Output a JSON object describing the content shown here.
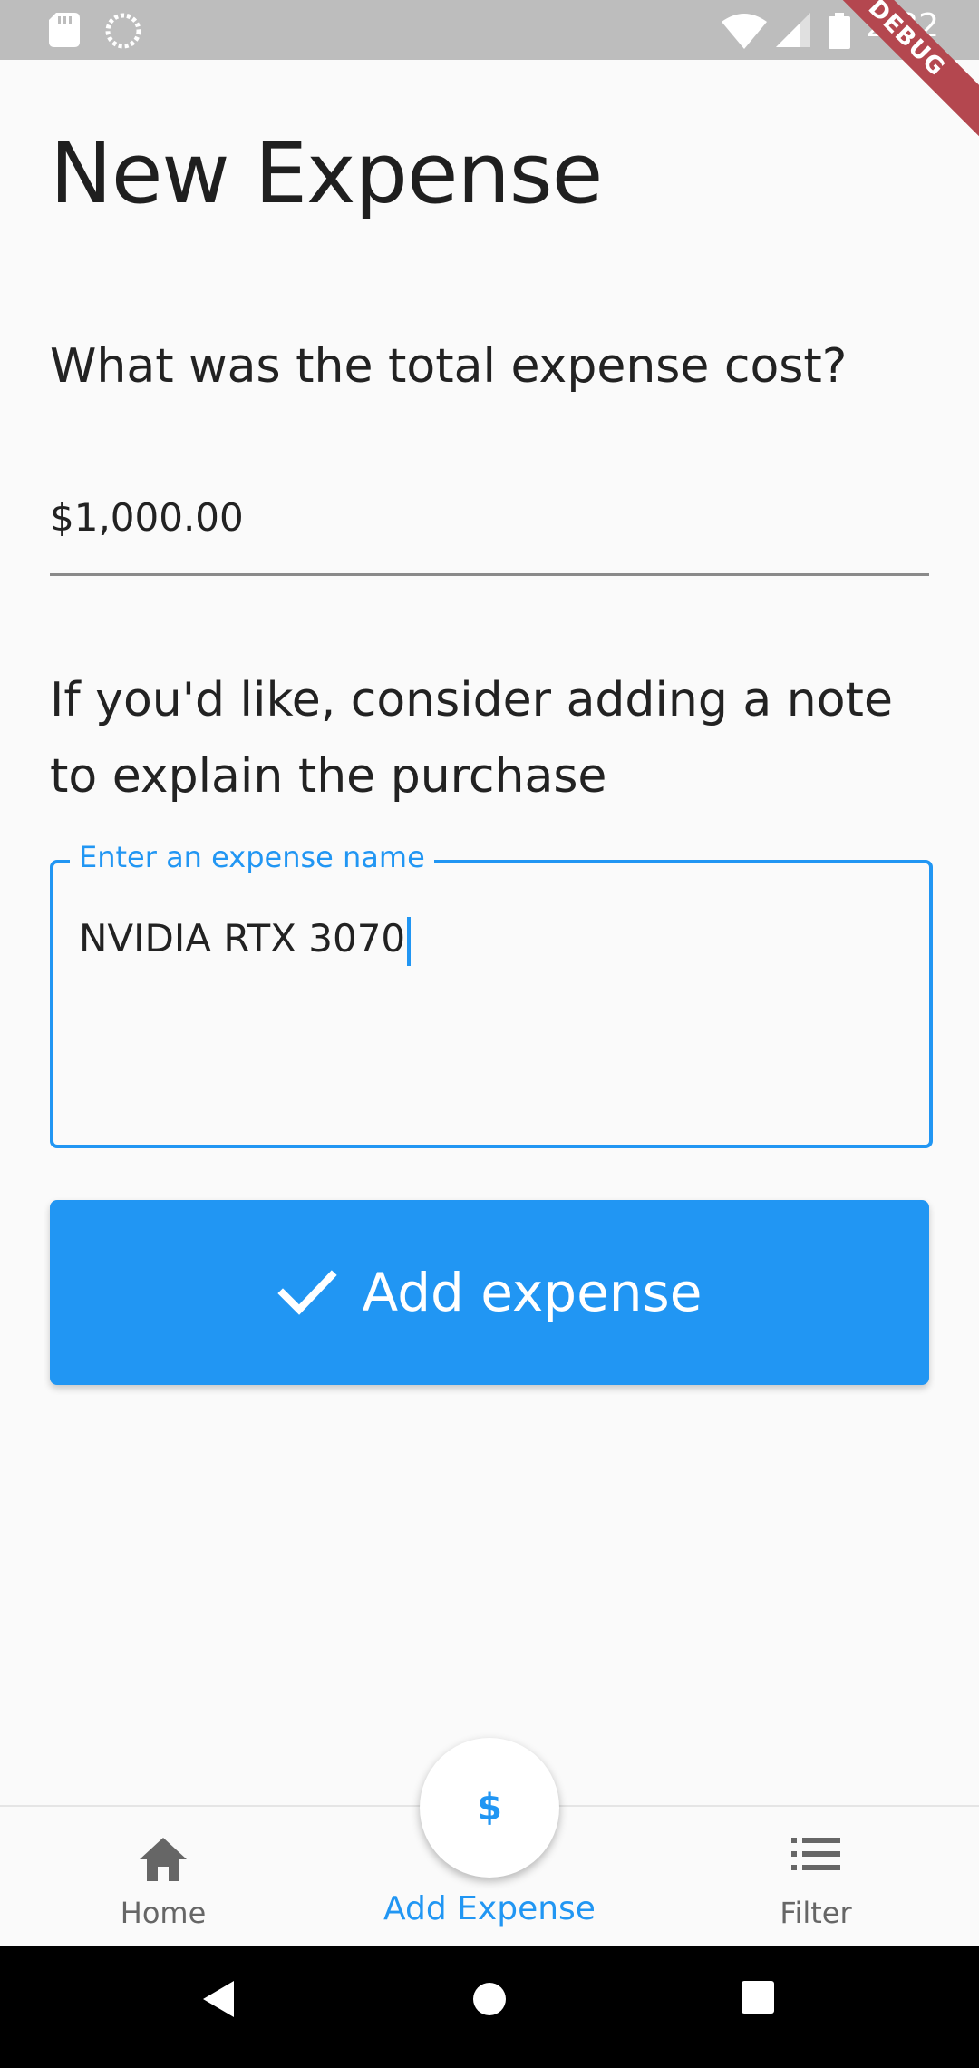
{
  "status_bar": {
    "time": "2:32",
    "debug_banner": "DEBUG",
    "icons": [
      "sd-card-icon",
      "sync-icon",
      "wifi-icon",
      "signal-icon",
      "battery-icon"
    ]
  },
  "page": {
    "title": "New Expense",
    "cost_question": "What was the total expense cost?",
    "cost_value": "$1,000.00",
    "note_prompt": "If you'd like, consider adding a note to explain the purchase",
    "note_label": "Enter an expense name",
    "note_value": "NVIDIA RTX 3070",
    "submit_label": "Add expense"
  },
  "bottom_nav": {
    "fab_symbol": "$",
    "items": [
      {
        "label": "Home",
        "icon": "home-icon",
        "active": false
      },
      {
        "label": "Add Expense",
        "icon": "add-expense-icon",
        "active": true
      },
      {
        "label": "Filter",
        "icon": "list-icon",
        "active": false
      }
    ]
  },
  "colors": {
    "accent": "#2196f3",
    "background": "#fafafa",
    "status_bar": "#bdbdbd",
    "debug_banner": "#b4474f"
  }
}
